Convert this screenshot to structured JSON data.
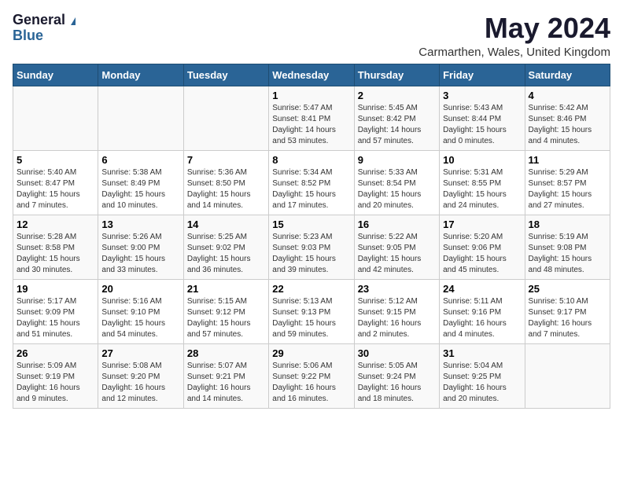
{
  "logo": {
    "general": "General",
    "blue": "Blue"
  },
  "title": "May 2024",
  "location": "Carmarthen, Wales, United Kingdom",
  "days_of_week": [
    "Sunday",
    "Monday",
    "Tuesday",
    "Wednesday",
    "Thursday",
    "Friday",
    "Saturday"
  ],
  "weeks": [
    [
      {
        "num": "",
        "info": ""
      },
      {
        "num": "",
        "info": ""
      },
      {
        "num": "",
        "info": ""
      },
      {
        "num": "1",
        "info": "Sunrise: 5:47 AM\nSunset: 8:41 PM\nDaylight: 14 hours and 53 minutes."
      },
      {
        "num": "2",
        "info": "Sunrise: 5:45 AM\nSunset: 8:42 PM\nDaylight: 14 hours and 57 minutes."
      },
      {
        "num": "3",
        "info": "Sunrise: 5:43 AM\nSunset: 8:44 PM\nDaylight: 15 hours and 0 minutes."
      },
      {
        "num": "4",
        "info": "Sunrise: 5:42 AM\nSunset: 8:46 PM\nDaylight: 15 hours and 4 minutes."
      }
    ],
    [
      {
        "num": "5",
        "info": "Sunrise: 5:40 AM\nSunset: 8:47 PM\nDaylight: 15 hours and 7 minutes."
      },
      {
        "num": "6",
        "info": "Sunrise: 5:38 AM\nSunset: 8:49 PM\nDaylight: 15 hours and 10 minutes."
      },
      {
        "num": "7",
        "info": "Sunrise: 5:36 AM\nSunset: 8:50 PM\nDaylight: 15 hours and 14 minutes."
      },
      {
        "num": "8",
        "info": "Sunrise: 5:34 AM\nSunset: 8:52 PM\nDaylight: 15 hours and 17 minutes."
      },
      {
        "num": "9",
        "info": "Sunrise: 5:33 AM\nSunset: 8:54 PM\nDaylight: 15 hours and 20 minutes."
      },
      {
        "num": "10",
        "info": "Sunrise: 5:31 AM\nSunset: 8:55 PM\nDaylight: 15 hours and 24 minutes."
      },
      {
        "num": "11",
        "info": "Sunrise: 5:29 AM\nSunset: 8:57 PM\nDaylight: 15 hours and 27 minutes."
      }
    ],
    [
      {
        "num": "12",
        "info": "Sunrise: 5:28 AM\nSunset: 8:58 PM\nDaylight: 15 hours and 30 minutes."
      },
      {
        "num": "13",
        "info": "Sunrise: 5:26 AM\nSunset: 9:00 PM\nDaylight: 15 hours and 33 minutes."
      },
      {
        "num": "14",
        "info": "Sunrise: 5:25 AM\nSunset: 9:02 PM\nDaylight: 15 hours and 36 minutes."
      },
      {
        "num": "15",
        "info": "Sunrise: 5:23 AM\nSunset: 9:03 PM\nDaylight: 15 hours and 39 minutes."
      },
      {
        "num": "16",
        "info": "Sunrise: 5:22 AM\nSunset: 9:05 PM\nDaylight: 15 hours and 42 minutes."
      },
      {
        "num": "17",
        "info": "Sunrise: 5:20 AM\nSunset: 9:06 PM\nDaylight: 15 hours and 45 minutes."
      },
      {
        "num": "18",
        "info": "Sunrise: 5:19 AM\nSunset: 9:08 PM\nDaylight: 15 hours and 48 minutes."
      }
    ],
    [
      {
        "num": "19",
        "info": "Sunrise: 5:17 AM\nSunset: 9:09 PM\nDaylight: 15 hours and 51 minutes."
      },
      {
        "num": "20",
        "info": "Sunrise: 5:16 AM\nSunset: 9:10 PM\nDaylight: 15 hours and 54 minutes."
      },
      {
        "num": "21",
        "info": "Sunrise: 5:15 AM\nSunset: 9:12 PM\nDaylight: 15 hours and 57 minutes."
      },
      {
        "num": "22",
        "info": "Sunrise: 5:13 AM\nSunset: 9:13 PM\nDaylight: 15 hours and 59 minutes."
      },
      {
        "num": "23",
        "info": "Sunrise: 5:12 AM\nSunset: 9:15 PM\nDaylight: 16 hours and 2 minutes."
      },
      {
        "num": "24",
        "info": "Sunrise: 5:11 AM\nSunset: 9:16 PM\nDaylight: 16 hours and 4 minutes."
      },
      {
        "num": "25",
        "info": "Sunrise: 5:10 AM\nSunset: 9:17 PM\nDaylight: 16 hours and 7 minutes."
      }
    ],
    [
      {
        "num": "26",
        "info": "Sunrise: 5:09 AM\nSunset: 9:19 PM\nDaylight: 16 hours and 9 minutes."
      },
      {
        "num": "27",
        "info": "Sunrise: 5:08 AM\nSunset: 9:20 PM\nDaylight: 16 hours and 12 minutes."
      },
      {
        "num": "28",
        "info": "Sunrise: 5:07 AM\nSunset: 9:21 PM\nDaylight: 16 hours and 14 minutes."
      },
      {
        "num": "29",
        "info": "Sunrise: 5:06 AM\nSunset: 9:22 PM\nDaylight: 16 hours and 16 minutes."
      },
      {
        "num": "30",
        "info": "Sunrise: 5:05 AM\nSunset: 9:24 PM\nDaylight: 16 hours and 18 minutes."
      },
      {
        "num": "31",
        "info": "Sunrise: 5:04 AM\nSunset: 9:25 PM\nDaylight: 16 hours and 20 minutes."
      },
      {
        "num": "",
        "info": ""
      }
    ]
  ]
}
